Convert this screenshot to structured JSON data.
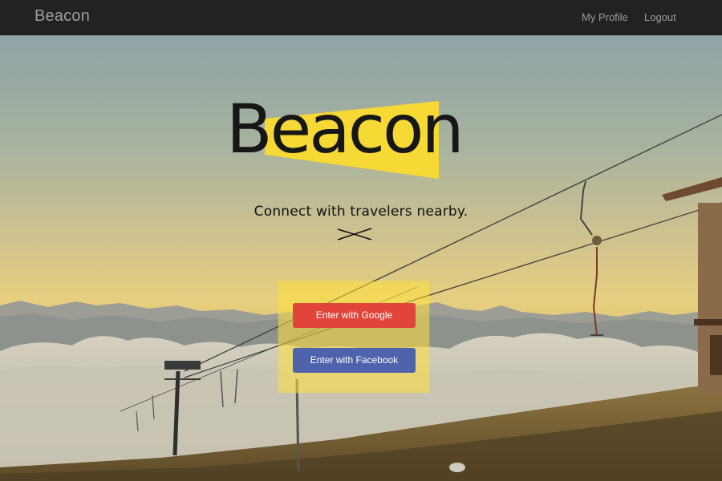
{
  "navbar": {
    "brand": "Beacon",
    "links": [
      {
        "label": "My Profile"
      },
      {
        "label": "Logout"
      }
    ]
  },
  "hero": {
    "logo_text": "Beacon",
    "tagline": "Connect with travelers nearby.",
    "buttons": {
      "google": "Enter with Google",
      "facebook": "Enter with Facebook"
    }
  },
  "colors": {
    "navbar_bg": "#222222",
    "nav_text": "#9d9d9d",
    "logo_accent": "#f6d935",
    "google_button": "#e1453a",
    "facebook_button": "#4e63ab",
    "panel": "#ffe03c"
  },
  "icons": {
    "tagline_divider": "x-divider-icon"
  }
}
